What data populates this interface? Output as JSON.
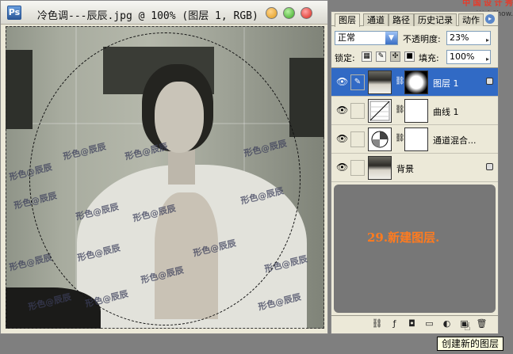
{
  "document_window": {
    "title": "冷色调---辰辰.jpg @ 100% (图层 1, RGB)",
    "app_icon_label": "Ps",
    "watermark_text": "形色@辰辰"
  },
  "brand": {
    "line1": "中 国 设 计 秀",
    "line2": "www.WebShow.com"
  },
  "layers_panel": {
    "tabs": [
      "图层",
      "通道",
      "路径",
      "历史记录",
      "动作"
    ],
    "active_tab": "图层",
    "blend_mode": "正常",
    "opacity_label": "不透明度:",
    "opacity_value": "23%",
    "lock_label": "锁定:",
    "fill_label": "填充:",
    "fill_value": "100%",
    "layers": [
      {
        "name": "图层 1",
        "selected": true,
        "has_mask": true
      },
      {
        "name": "曲线 1",
        "selected": false,
        "has_mask": true
      },
      {
        "name": "通道混合...",
        "selected": false,
        "has_mask": true
      },
      {
        "name": "背景",
        "selected": false,
        "has_mask": false,
        "locked": true
      }
    ],
    "note": "29.新建图层."
  },
  "tooltip": "创建新的图层",
  "colors": {
    "selection": "#316ac5",
    "note_text": "#ff7b1f",
    "panel_bg": "#ece9d8"
  }
}
